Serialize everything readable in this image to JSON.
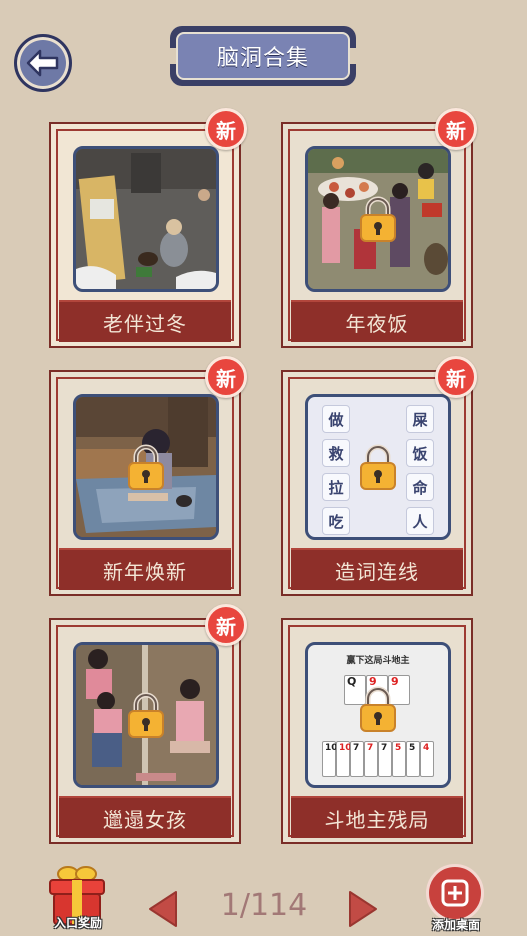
{
  "header": {
    "title": "脑洞合集"
  },
  "badge": {
    "new_label": "新"
  },
  "cards": [
    {
      "title": "老伴过冬",
      "is_new": true,
      "locked": false
    },
    {
      "title": "年夜饭",
      "is_new": true,
      "locked": true
    },
    {
      "title": "新年焕新",
      "is_new": true,
      "locked": true
    },
    {
      "title": "造词连线",
      "is_new": true,
      "locked": true
    },
    {
      "title": "邋遢女孩",
      "is_new": true,
      "locked": true
    },
    {
      "title": "斗地主残局",
      "is_new": false,
      "locked": true
    }
  ],
  "word_grid": {
    "left": [
      "做",
      "救",
      "拉",
      "吃"
    ],
    "right": [
      "屎",
      "饭",
      "命",
      "人"
    ]
  },
  "card_game": {
    "caption": "赢下这局斗地主",
    "top_cards": [
      "Q",
      "9",
      "9"
    ],
    "bottom_cards": [
      "10",
      "10",
      "7",
      "7",
      "7",
      "5",
      "5",
      "4"
    ]
  },
  "footer": {
    "reward_label": "入口奖励",
    "page": "1/114",
    "add_desktop_label": "添加桌面"
  },
  "colors": {
    "background": "#d9cbb7",
    "label_bar": "#8e2f29",
    "badge": "#e8463e",
    "title_plaque": "#7a83b3"
  }
}
